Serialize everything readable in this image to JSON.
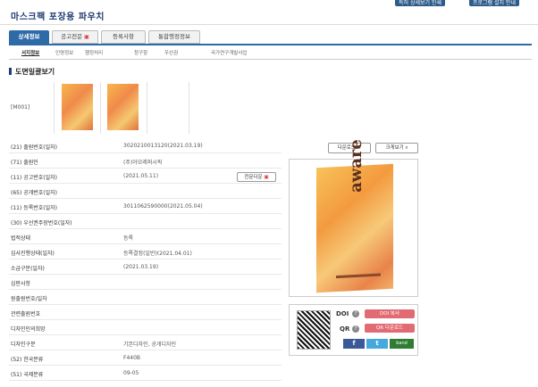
{
  "top_buttons": [
    "특허 상세보기 인쇄",
    "프로그램 설치 안내"
  ],
  "page_title": "마스크팩 포장용 파우치",
  "tabs": [
    "상세정보",
    "공고전문",
    "등록사항",
    "통합행정정보"
  ],
  "subtabs": [
    "서지정보",
    "인명정보",
    "행정처리",
    "청구항",
    "우선권",
    "국가연구개발사업"
  ],
  "section_title": "도면일괄보기",
  "drawing_label": "[M001]",
  "fields": [
    {
      "k": "(21) 출원번호(일자)",
      "v": "3020210013120(2021.03.19)"
    },
    {
      "k": "(71) 출원인",
      "v": "(주)아모레퍼시픽"
    },
    {
      "k": "(11) 공고번호(일자)",
      "v": "(2021.05.11)"
    },
    {
      "k": "(65) 공개번호(일자)",
      "v": ""
    },
    {
      "k": "(11) 등록번호(일자)",
      "v": "3011062590000(2021.05.04)"
    },
    {
      "k": "(30) 우선권주장번호(일자)",
      "v": ""
    },
    {
      "k": "법적상태",
      "v": "등록"
    },
    {
      "k": "심사진행상태(일자)",
      "v": "등록결정(일반)(2021.04.01)"
    },
    {
      "k": "소급구분(일자)",
      "v": "(2021.03.19)"
    },
    {
      "k": "심판사항",
      "v": ""
    },
    {
      "k": "원출원번호/일자",
      "v": ""
    },
    {
      "k": "관련출원번호",
      "v": ""
    },
    {
      "k": "디자인인의희망",
      "v": ""
    },
    {
      "k": "디자인구분",
      "v": "기본디자인, 공개디자인"
    },
    {
      "k": "(52) 한국분류",
      "v": "F440B"
    },
    {
      "k": "(51) 국제분류",
      "v": "09-05"
    }
  ],
  "full_text_btn": "전문다운",
  "download_btn": "다운로드",
  "zoom_btn": "크게보기",
  "product_text": "aware",
  "doi_label": "DOI",
  "qr_label": "QR",
  "doi_copy_btn": "DOI 복사",
  "qr_download_btn": "QR 다운로드",
  "share_icons": [
    "f",
    "t",
    "band"
  ],
  "colors": {
    "brand": "#2f6aa8",
    "title": "#1f3d73",
    "pink": "#e26b73"
  }
}
